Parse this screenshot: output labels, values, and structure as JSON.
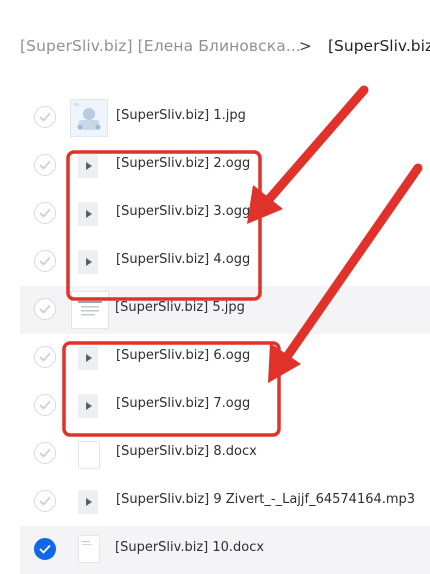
{
  "breadcrumb": {
    "parent": "[SuperSliv.biz] [Елена Блиновска...",
    "separator": ">",
    "current": "[SuperSliv.biz"
  },
  "files": [
    {
      "name": "[SuperSliv.biz] 1.jpg",
      "type": "image",
      "checked": false
    },
    {
      "name": "[SuperSliv.biz] 2.ogg",
      "type": "audio",
      "checked": false
    },
    {
      "name": "[SuperSliv.biz] 3.ogg",
      "type": "audio",
      "checked": false
    },
    {
      "name": "[SuperSliv.biz] 4.ogg",
      "type": "audio",
      "checked": false
    },
    {
      "name": "[SuperSliv.biz] 5.jpg",
      "type": "image",
      "checked": false
    },
    {
      "name": "[SuperSliv.biz] 6.ogg",
      "type": "audio",
      "checked": false
    },
    {
      "name": "[SuperSliv.biz] 7.ogg",
      "type": "audio",
      "checked": false
    },
    {
      "name": "[SuperSliv.biz] 8.docx",
      "type": "document",
      "checked": false
    },
    {
      "name": "[SuperSliv.biz] 9 Zivert_-_Lajjf_64574164.mp3",
      "type": "audio",
      "checked": false
    },
    {
      "name": "[SuperSliv.biz] 10.docx",
      "type": "document",
      "checked": true
    }
  ],
  "colors": {
    "annotation_red": "#e0322a",
    "checked_blue": "#1267e8"
  }
}
